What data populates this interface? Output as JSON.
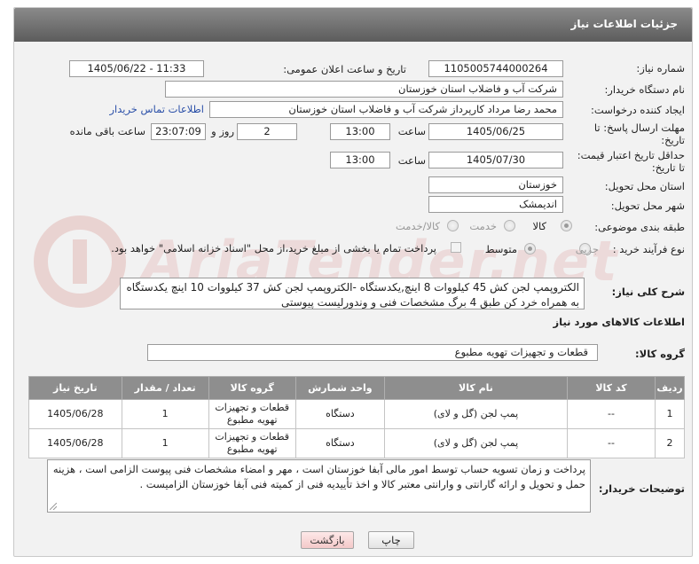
{
  "header": {
    "title": "جزئیات اطلاعات نیاز"
  },
  "form": {
    "need_number_label": "شماره نیاز:",
    "need_number": "1105005744000264",
    "announce_label": "تاریخ و ساعت اعلان عمومی:",
    "announce_value": "1405/06/22 - 11:33",
    "buyer_org_label": "نام دستگاه خریدار:",
    "buyer_org": "شرکت آب و فاضلاب استان خوزستان",
    "creator_label": "ایجاد کننده درخواست:",
    "creator": "محمد رضا مرداد کارپرداز شرکت آب و فاضلاب استان خوزستان",
    "contact_link": "اطلاعات تماس خریدار",
    "deadline_label_1": "مهلت ارسال پاسخ: تا",
    "deadline_label_2": "تاریخ:",
    "deadline_date": "1405/06/25",
    "time_label": "ساعت",
    "deadline_time": "13:00",
    "days_value": "2",
    "days_label": "روز و",
    "remaining_time": "23:07:09",
    "remaining_label": "ساعت باقی مانده",
    "validity_label_1": "حداقل تاریخ اعتبار قیمت:",
    "validity_label_2": "تا تاریخ:",
    "validity_date": "1405/07/30",
    "validity_time_label": "ساعت",
    "validity_time": "13:00",
    "province_label": "استان محل تحویل:",
    "province": "خوزستان",
    "city_label": "شهر محل تحویل:",
    "city": "اندیمشک",
    "category_label": "طبقه بندی موضوعی:",
    "category_options": [
      "کالا",
      "خدمت",
      "کالا/خدمت"
    ],
    "purchase_type_label": "نوع فرآیند خرید :",
    "purchase_options": [
      "جزیی",
      "متوسط"
    ],
    "payment_note": "پرداخت تمام یا بخشی از مبلغ خرید،از محل \"اسناد خزانه اسلامی\" خواهد بود."
  },
  "description": {
    "label": "شرح کلی نیاز:",
    "text": "الکتروپمپ لجن کش 45 کیلووات 8 اینچ,یکدستگاه -الکتروپمپ لجن کش 37 کیلووات 10 اینچ یکدستگاه به همراه خرد کن طبق 4 برگ مشخصات فنی و وندورلیست پیوستی"
  },
  "goods": {
    "section_title": "اطلاعات کالاهای مورد نیاز",
    "group_label": "گروه کالا:",
    "group_value": "قطعات و تجهیزات تهویه مطبوع",
    "columns": [
      "ردیف",
      "کد کالا",
      "نام کالا",
      "واحد شمارش",
      "گروه کالا",
      "تعداد / مقدار",
      "تاریخ نیاز"
    ],
    "rows": [
      {
        "row": "1",
        "code": "--",
        "name": "پمپ لجن (گل و لای)",
        "unit": "دستگاه",
        "group_line1": "قطعات و تجهیزات",
        "group_line2": "تهویه مطبوع",
        "qty": "1",
        "date": "1405/06/28"
      },
      {
        "row": "2",
        "code": "--",
        "name": "پمپ لجن (گل و لای)",
        "unit": "دستگاه",
        "group_line1": "قطعات و تجهیزات",
        "group_line2": "تهویه مطبوع",
        "qty": "1",
        "date": "1405/06/28"
      }
    ]
  },
  "buyer_notes": {
    "label": "توضیحات خریدار:",
    "text": "پرداخت و زمان تسویه حساب توسط امور مالی آبفا خوزستان است ، مهر و امضاء مشخصات فنی پیوست الزامی است ، هزینه حمل و تحویل و ارائه گارانتی و وارانتی معتبر کالا و اخذ تأییدیه فنی از کمیته فنی آبفا خوزستان الزامیست ."
  },
  "buttons": {
    "print": "چاپ",
    "back": "بازگشت"
  },
  "watermark": {
    "text": "AriaTender.net"
  }
}
